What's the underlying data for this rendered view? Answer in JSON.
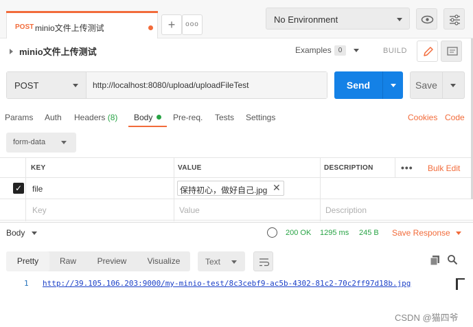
{
  "request_tab": {
    "method": "POST",
    "name": "minio文件上传测试"
  },
  "tab_buttons": {
    "add": "+",
    "more": "ooo"
  },
  "environment": {
    "selected": "No Environment"
  },
  "title_row": {
    "title": "minio文件上传测试",
    "examples_label": "Examples",
    "examples_count": "0",
    "build_label": "BUILD"
  },
  "url_bar": {
    "method": "POST",
    "url": "http://localhost:8080/upload/uploadFileTest",
    "send_label": "Send",
    "save_label": "Save"
  },
  "request_tabs": {
    "params": "Params",
    "auth": "Auth",
    "headers": "Headers",
    "headers_count": "(8)",
    "body": "Body",
    "prereq": "Pre-req.",
    "tests": "Tests",
    "settings": "Settings",
    "cookies": "Cookies",
    "code": "Code"
  },
  "body_type": {
    "selected": "form-data"
  },
  "params_table": {
    "headers": {
      "key": "KEY",
      "value": "VALUE",
      "description": "DESCRIPTION"
    },
    "more": "•••",
    "bulk_edit": "Bulk Edit",
    "rows": [
      {
        "checked": true,
        "key": "file",
        "value": "保持初心，做好自己.jpg",
        "description": ""
      }
    ],
    "placeholders": {
      "key": "Key",
      "value": "Value",
      "description": "Description"
    }
  },
  "response_bar": {
    "body_label": "Body",
    "status": "200 OK",
    "time": "1295 ms",
    "size": "245 B",
    "save_response": "Save Response"
  },
  "response_tabs": {
    "tabs": [
      "Pretty",
      "Raw",
      "Preview",
      "Visualize"
    ],
    "active": "Pretty",
    "format": "Text"
  },
  "response_body": {
    "line_number": "1",
    "content": "http://39.105.106.203:9000/my-minio-test/8c3cebf9-ac5b-4302-81c2-70c2ff97d18b.jpg"
  },
  "watermark": "CSDN @猫四爷",
  "colors": {
    "accent": "#f26b3a",
    "send": "#1481e6",
    "success": "#27a344",
    "link": "#1a3fc7"
  }
}
